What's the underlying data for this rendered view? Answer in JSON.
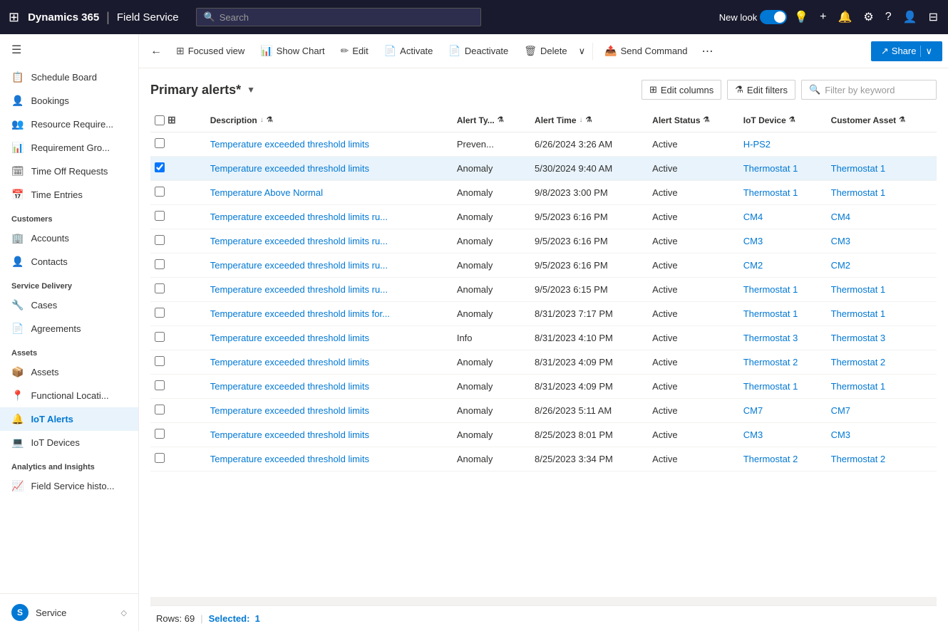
{
  "topnav": {
    "app_name": "Dynamics 365",
    "divider": "|",
    "module_name": "Field Service",
    "search_placeholder": "Search",
    "new_look_label": "New look",
    "icons": {
      "waffle": "⊞",
      "lightbulb": "💡",
      "plus": "+",
      "bell": "🔔",
      "gear": "⚙",
      "question": "?",
      "user": "👤",
      "apps": "⊟"
    }
  },
  "toolbar": {
    "back_icon": "←",
    "focused_view_label": "Focused view",
    "show_chart_label": "Show Chart",
    "edit_label": "Edit",
    "activate_label": "Activate",
    "deactivate_label": "Deactivate",
    "delete_label": "Delete",
    "more_icon": "∨",
    "send_command_label": "Send Command",
    "ellipsis": "⋯",
    "share_label": "Share",
    "share_dropdown": "∨"
  },
  "grid": {
    "title": "Primary alerts*",
    "title_chevron": "▼",
    "edit_columns_label": "Edit columns",
    "edit_filters_label": "Edit filters",
    "filter_placeholder": "Filter by keyword",
    "columns": [
      {
        "key": "description",
        "label": "Description",
        "sortable": true,
        "sort_icon": "↓"
      },
      {
        "key": "alert_type",
        "label": "Alert Ty...",
        "sortable": true,
        "sort_icon": ""
      },
      {
        "key": "alert_time",
        "label": "Alert Time",
        "sortable": true,
        "sort_icon": "↓"
      },
      {
        "key": "alert_status",
        "label": "Alert Status",
        "sortable": true,
        "sort_icon": ""
      },
      {
        "key": "iot_device",
        "label": "IoT Device",
        "sortable": true,
        "sort_icon": ""
      },
      {
        "key": "customer_asset",
        "label": "Customer Asset",
        "sortable": true,
        "sort_icon": ""
      }
    ],
    "rows": [
      {
        "id": 1,
        "selected": false,
        "description": "Temperature exceeded threshold limits",
        "alert_type": "Preven...",
        "alert_time": "6/26/2024 3:26 AM",
        "alert_status": "Active",
        "iot_device": "H-PS2",
        "customer_asset": "",
        "device_link": true,
        "asset_link": false
      },
      {
        "id": 2,
        "selected": true,
        "description": "Temperature exceeded threshold limits",
        "alert_type": "Anomaly",
        "alert_time": "5/30/2024 9:40 AM",
        "alert_status": "Active",
        "iot_device": "Thermostat 1",
        "customer_asset": "Thermostat 1",
        "device_link": true,
        "asset_link": true
      },
      {
        "id": 3,
        "selected": false,
        "description": "Temperature Above Normal",
        "alert_type": "Anomaly",
        "alert_time": "9/8/2023 3:00 PM",
        "alert_status": "Active",
        "iot_device": "Thermostat 1",
        "customer_asset": "Thermostat 1",
        "device_link": true,
        "asset_link": true
      },
      {
        "id": 4,
        "selected": false,
        "description": "Temperature exceeded threshold limits ru...",
        "alert_type": "Anomaly",
        "alert_time": "9/5/2023 6:16 PM",
        "alert_status": "Active",
        "iot_device": "CM4",
        "customer_asset": "CM4",
        "device_link": true,
        "asset_link": true
      },
      {
        "id": 5,
        "selected": false,
        "description": "Temperature exceeded threshold limits ru...",
        "alert_type": "Anomaly",
        "alert_time": "9/5/2023 6:16 PM",
        "alert_status": "Active",
        "iot_device": "CM3",
        "customer_asset": "CM3",
        "device_link": true,
        "asset_link": true
      },
      {
        "id": 6,
        "selected": false,
        "description": "Temperature exceeded threshold limits ru...",
        "alert_type": "Anomaly",
        "alert_time": "9/5/2023 6:16 PM",
        "alert_status": "Active",
        "iot_device": "CM2",
        "customer_asset": "CM2",
        "device_link": true,
        "asset_link": true
      },
      {
        "id": 7,
        "selected": false,
        "description": "Temperature exceeded threshold limits ru...",
        "alert_type": "Anomaly",
        "alert_time": "9/5/2023 6:15 PM",
        "alert_status": "Active",
        "iot_device": "Thermostat 1",
        "customer_asset": "Thermostat 1",
        "device_link": true,
        "asset_link": true
      },
      {
        "id": 8,
        "selected": false,
        "description": "Temperature exceeded threshold limits for...",
        "alert_type": "Anomaly",
        "alert_time": "8/31/2023 7:17 PM",
        "alert_status": "Active",
        "iot_device": "Thermostat 1",
        "customer_asset": "Thermostat 1",
        "device_link": true,
        "asset_link": true
      },
      {
        "id": 9,
        "selected": false,
        "description": "Temperature exceeded threshold limits",
        "alert_type": "Info",
        "alert_time": "8/31/2023 4:10 PM",
        "alert_status": "Active",
        "iot_device": "Thermostat 3",
        "customer_asset": "Thermostat 3",
        "device_link": true,
        "asset_link": true
      },
      {
        "id": 10,
        "selected": false,
        "description": "Temperature exceeded threshold limits",
        "alert_type": "Anomaly",
        "alert_time": "8/31/2023 4:09 PM",
        "alert_status": "Active",
        "iot_device": "Thermostat 2",
        "customer_asset": "Thermostat 2",
        "device_link": true,
        "asset_link": true
      },
      {
        "id": 11,
        "selected": false,
        "description": "Temperature exceeded threshold limits",
        "alert_type": "Anomaly",
        "alert_time": "8/31/2023 4:09 PM",
        "alert_status": "Active",
        "iot_device": "Thermostat 1",
        "customer_asset": "Thermostat 1",
        "device_link": true,
        "asset_link": true
      },
      {
        "id": 12,
        "selected": false,
        "description": "Temperature exceeded threshold limits",
        "alert_type": "Anomaly",
        "alert_time": "8/26/2023 5:11 AM",
        "alert_status": "Active",
        "iot_device": "CM7",
        "customer_asset": "CM7",
        "device_link": true,
        "asset_link": true
      },
      {
        "id": 13,
        "selected": false,
        "description": "Temperature exceeded threshold limits",
        "alert_type": "Anomaly",
        "alert_time": "8/25/2023 8:01 PM",
        "alert_status": "Active",
        "iot_device": "CM3",
        "customer_asset": "CM3",
        "device_link": true,
        "asset_link": true
      },
      {
        "id": 14,
        "selected": false,
        "description": "Temperature exceeded threshold limits",
        "alert_type": "Anomaly",
        "alert_time": "8/25/2023 3:34 PM",
        "alert_status": "Active",
        "iot_device": "Thermostat 2",
        "customer_asset": "Thermostat 2",
        "device_link": true,
        "asset_link": true
      }
    ],
    "footer_rows_label": "Rows: 69",
    "footer_selected_label": "Selected:",
    "footer_selected_count": "1"
  },
  "sidebar": {
    "hamburger_icon": "☰",
    "sections": [
      {
        "items": [
          {
            "label": "Schedule Board",
            "icon": "📋"
          },
          {
            "label": "Bookings",
            "icon": "👤"
          },
          {
            "label": "Resource Require...",
            "icon": "👥"
          },
          {
            "label": "Requirement Gro...",
            "icon": "📊"
          },
          {
            "label": "Time Off Requests",
            "icon": "🗓"
          },
          {
            "label": "Time Entries",
            "icon": "📅"
          }
        ]
      },
      {
        "section_label": "Customers",
        "items": [
          {
            "label": "Accounts",
            "icon": "🏢"
          },
          {
            "label": "Contacts",
            "icon": "👤"
          }
        ]
      },
      {
        "section_label": "Service Delivery",
        "items": [
          {
            "label": "Cases",
            "icon": "🔧"
          },
          {
            "label": "Agreements",
            "icon": "📄"
          }
        ]
      },
      {
        "section_label": "Assets",
        "items": [
          {
            "label": "Assets",
            "icon": "📦"
          },
          {
            "label": "Functional Locati...",
            "icon": "📍"
          },
          {
            "label": "IoT Alerts",
            "icon": "🔔",
            "active": true
          },
          {
            "label": "IoT Devices",
            "icon": "💻"
          }
        ]
      },
      {
        "section_label": "Analytics and Insights",
        "items": [
          {
            "label": "Field Service histo...",
            "icon": "📈"
          }
        ]
      }
    ],
    "bottom": {
      "avatar_letter": "S",
      "label": "Service"
    }
  }
}
